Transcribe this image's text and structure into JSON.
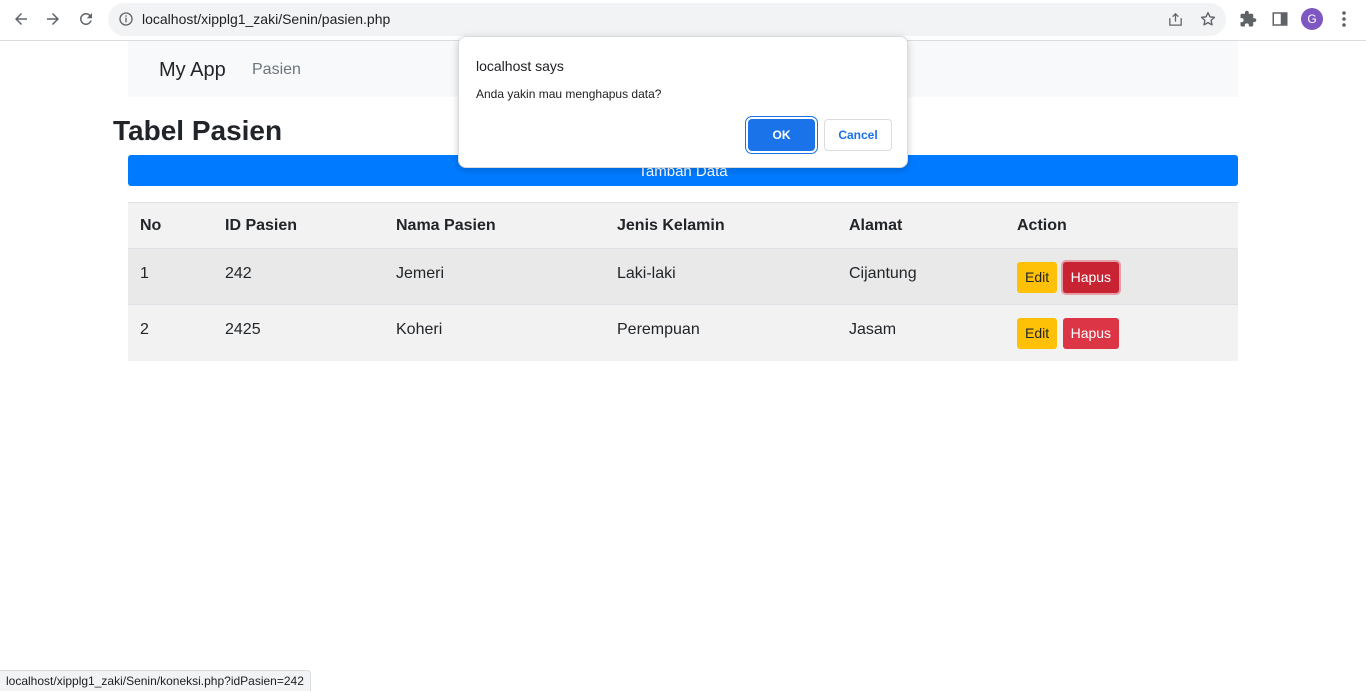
{
  "browser": {
    "url": "localhost/xipplg1_zaki/Senin/pasien.php",
    "avatar_letter": "G",
    "status_url": "localhost/xipplg1_zaki/Senin/koneksi.php?idPasien=242"
  },
  "navbar": {
    "brand": "My App",
    "link": "Pasien"
  },
  "main": {
    "title": "Tabel Pasien",
    "add_button": "Tambah Data",
    "table": {
      "headers": [
        "No",
        "ID Pasien",
        "Nama Pasien",
        "Jenis Kelamin",
        "Alamat",
        "Action"
      ],
      "rows": [
        {
          "no": "1",
          "id": "242",
          "name": "Jemeri",
          "gender": "Laki-laki",
          "address": "Cijantung",
          "edit": "Edit",
          "delete": "Hapus"
        },
        {
          "no": "2",
          "id": "2425",
          "name": "Koheri",
          "gender": "Perempuan",
          "address": "Jasam",
          "edit": "Edit",
          "delete": "Hapus"
        }
      ]
    }
  },
  "dialog": {
    "title": "localhost says",
    "message": "Anda yakin mau menghapus data?",
    "ok_label": "OK",
    "cancel_label": "Cancel"
  }
}
